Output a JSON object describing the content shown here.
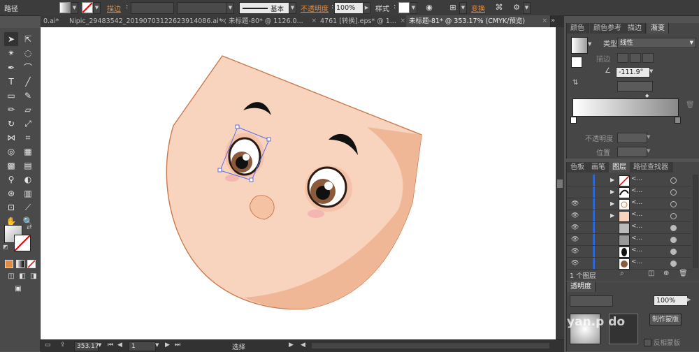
{
  "control_bar": {
    "object_type": "路径",
    "stroke_label": "描边",
    "brush_label": "基本",
    "opacity_label": "不透明度",
    "opacity_value": "100%",
    "style_label": "样式",
    "transform_label": "变换"
  },
  "tabs": [
    {
      "label": "0.ai*"
    },
    {
      "label": "Nipic_29483542_20190703122623914086.ai* @"
    },
    {
      "label": "未标题-80* @ 1126.0..."
    },
    {
      "label": "4761 [转换].eps* @ 1..."
    },
    {
      "label": "未标题-81* @ 353.17% (CMYK/预览)"
    }
  ],
  "status_bar": {
    "zoom": "353.17",
    "artboard": "1",
    "tool_name": "选择"
  },
  "gradient_panel": {
    "tabs": [
      "颜色",
      "颜色参考",
      "描边",
      "渐变"
    ],
    "type_label": "类型:",
    "type_value": "线性",
    "stroke_label": "描边",
    "angle_value": "-111.9°",
    "opacity_label": "不透明度",
    "position_label": "位置"
  },
  "layers_panel": {
    "tabs": [
      "色板",
      "画笔",
      "图层",
      "路径查找器"
    ],
    "rows": [
      {
        "name": "<..."
      },
      {
        "name": "<..."
      },
      {
        "name": "<..."
      },
      {
        "name": "<..."
      },
      {
        "name": "<..."
      },
      {
        "name": "<..."
      },
      {
        "name": "<..."
      },
      {
        "name": "<..."
      }
    ],
    "layer_count": "1 个图层"
  },
  "transparency_panel": {
    "title": "透明度",
    "opacity_value": "100%",
    "make_mask_label": "制作蒙版",
    "invert_mask_label": "反相蒙版"
  },
  "watermark": {
    "text": "yan.p do"
  }
}
